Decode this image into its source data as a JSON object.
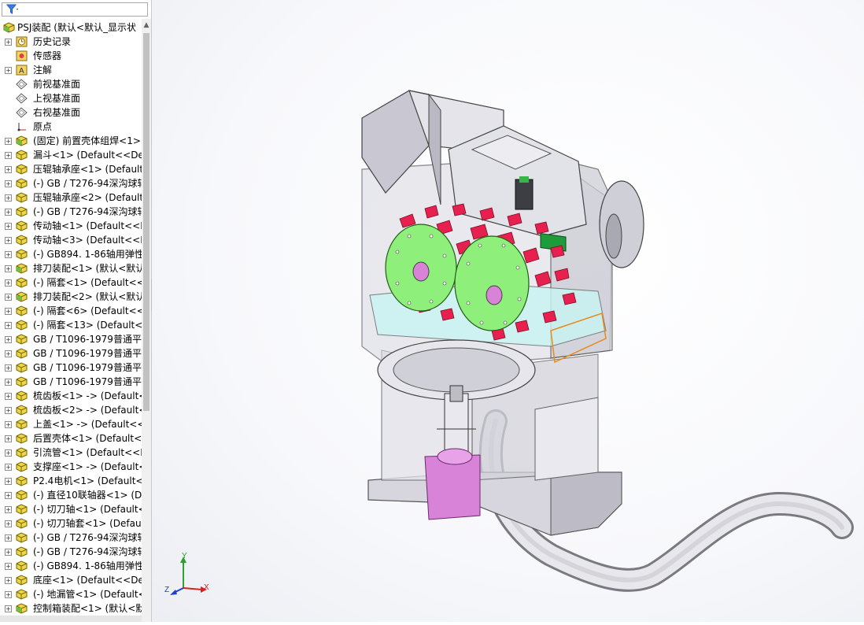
{
  "filter": {
    "icon": "filter-icon",
    "arrow": "▾"
  },
  "tree": {
    "root": "PSJ装配 (默认<默认_显示状",
    "items": [
      {
        "label": "历史记录",
        "icon": "history-icon"
      },
      {
        "label": "传感器",
        "icon": "sensor-icon"
      },
      {
        "label": "注解",
        "icon": "annotation-icon"
      },
      {
        "label": "前视基准面",
        "icon": "plane-icon"
      },
      {
        "label": "上视基准面",
        "icon": "plane-icon"
      },
      {
        "label": "右视基准面",
        "icon": "plane-icon"
      },
      {
        "label": "原点",
        "icon": "origin-icon"
      },
      {
        "label": "(固定) 前置壳体组焊<1>",
        "icon": "assembly-icon"
      },
      {
        "label": "漏斗<1> (Default<<Def",
        "icon": "part-icon"
      },
      {
        "label": "压辊轴承座<1> (Default",
        "icon": "part-icon"
      },
      {
        "label": "(-) GB / T276-94深沟球轴",
        "icon": "part-icon"
      },
      {
        "label": "压辊轴承座<2> (Default",
        "icon": "part-icon"
      },
      {
        "label": "(-) GB / T276-94深沟球轴",
        "icon": "part-icon"
      },
      {
        "label": "传动轴<1> (Default<<D",
        "icon": "part-icon"
      },
      {
        "label": "传动轴<3> (Default<<D",
        "icon": "part-icon"
      },
      {
        "label": "(-) GB894. 1-86轴用弹性",
        "icon": "part-icon"
      },
      {
        "label": "排刀装配<1> (默认<默认",
        "icon": "assembly-icon"
      },
      {
        "label": "(-) 隔套<1> (Default<<",
        "icon": "part-icon"
      },
      {
        "label": "排刀装配<2> (默认<默认",
        "icon": "assembly-icon"
      },
      {
        "label": "(-) 隔套<6> (Default<<",
        "icon": "part-icon"
      },
      {
        "label": "(-) 隔套<13> (Default<<",
        "icon": "part-icon"
      },
      {
        "label": "GB / T1096-1979普通平键",
        "icon": "part-icon"
      },
      {
        "label": "GB / T1096-1979普通平键",
        "icon": "part-icon"
      },
      {
        "label": "GB / T1096-1979普通平键",
        "icon": "part-icon"
      },
      {
        "label": "GB / T1096-1979普通平键",
        "icon": "part-icon"
      },
      {
        "label": "梳齿板<1> -> (Default<",
        "icon": "part-icon"
      },
      {
        "label": "梳齿板<2> -> (Default<",
        "icon": "part-icon"
      },
      {
        "label": "上盖<1> -> (Default<<",
        "icon": "part-icon"
      },
      {
        "label": "后置壳体<1> (Default<<",
        "icon": "part-icon"
      },
      {
        "label": "引流管<1> (Default<<D",
        "icon": "part-icon"
      },
      {
        "label": "支撑座<1> -> (Default<",
        "icon": "part-icon"
      },
      {
        "label": "P2.4电机<1> (Default<<",
        "icon": "part-icon"
      },
      {
        "label": "(-) 直径10联轴器<1> (De",
        "icon": "part-icon"
      },
      {
        "label": "(-) 切刀轴<1> (Default<<",
        "icon": "part-icon"
      },
      {
        "label": "(-) 切刀轴套<1> (Defaul",
        "icon": "part-icon"
      },
      {
        "label": "(-) GB / T276-94深沟球轴",
        "icon": "part-icon"
      },
      {
        "label": "(-) GB / T276-94深沟球轴",
        "icon": "part-icon"
      },
      {
        "label": "(-) GB894. 1-86轴用弹性",
        "icon": "part-icon"
      },
      {
        "label": "底座<1> (Default<<Def",
        "icon": "part-icon"
      },
      {
        "label": "(-) 地漏管<1> (Default<<",
        "icon": "part-icon"
      },
      {
        "label": "控制箱装配<1> (默认<默",
        "icon": "assembly-icon"
      }
    ]
  },
  "triad": {
    "x": "X",
    "y": "Y",
    "z": "Z"
  },
  "colors": {
    "accent": "#1f5fbf",
    "blades": "#e8204f",
    "disc": "#8ef07a",
    "pink": "#d882d8",
    "shell": "#cfcfd6"
  }
}
